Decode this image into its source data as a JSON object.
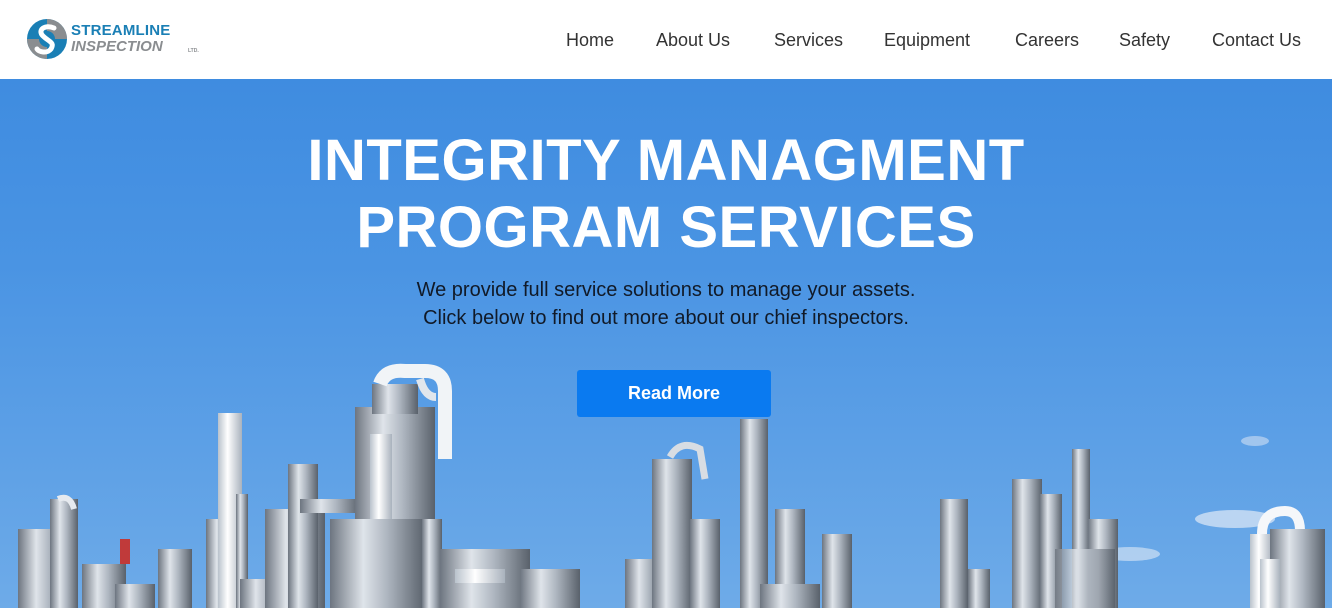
{
  "brand": {
    "line1": "STREAMLINE",
    "line2": "INSPECTION",
    "suffix": "LTD.",
    "primary_color": "#1a7fb5",
    "secondary_color": "#8a8d90"
  },
  "nav": {
    "items": [
      {
        "label": "Home"
      },
      {
        "label": "About Us"
      },
      {
        "label": "Services"
      },
      {
        "label": "Equipment"
      },
      {
        "label": "Careers"
      },
      {
        "label": "Safety"
      },
      {
        "label": "Contact Us"
      }
    ]
  },
  "hero": {
    "title_line1": "INTEGRITY MANAGMENT",
    "title_line2": "PROGRAM SERVICES",
    "subtitle_line1": "We provide full service solutions to manage your assets.",
    "subtitle_line2": "Click below to find out more about our chief inspectors.",
    "cta_label": "Read More",
    "cta_color": "#0a7af0",
    "background_image": "industrial refinery towers under blue sky"
  }
}
